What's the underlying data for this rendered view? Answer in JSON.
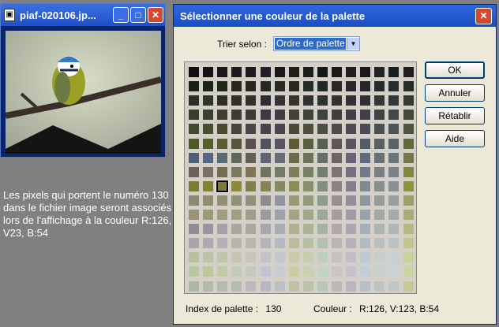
{
  "image_window": {
    "title": "piaf-020106.jp...",
    "minimize": "_",
    "maximize": "□",
    "close": "✕"
  },
  "caption": "Les pixels qui portent le numéro 130 dans le fichier image seront associés lors de l'affichage à la couleur R:126, V23, B:54",
  "dialog": {
    "title": "Sélectionner une couleur de la palette",
    "close": "✕",
    "sort_label": "Trier selon :",
    "sort_value": "Ordre de palette",
    "buttons": {
      "ok": "OK",
      "cancel": "Annuler",
      "reset": "Rétablir",
      "help": "Aide"
    },
    "index_label": "Index de palette :",
    "index_value": "130",
    "color_label": "Couleur :",
    "color_value": "R:126, V:123, B:54"
  },
  "palette": {
    "columns": 16,
    "rows": 16,
    "selected_index": 130,
    "row_colors": [
      [
        "#101010",
        "#141414",
        "#181818",
        "#1a1a22",
        "#1c1c20",
        "#20202a",
        "#1a1a1a",
        "#202018",
        "#18201a",
        "#101818",
        "#1c1818",
        "#202020",
        "#18181e",
        "#222222",
        "#161e1e",
        "#1e1e1e"
      ],
      [
        "#182018",
        "#1c2418",
        "#202818",
        "#26261c",
        "#28241e",
        "#242824",
        "#2a2a24",
        "#282a20",
        "#242c28",
        "#202828",
        "#2c2626",
        "#28282c",
        "#26262a",
        "#242a2a",
        "#262c2c",
        "#282c28"
      ],
      [
        "#283028",
        "#30342a",
        "#2c3024",
        "#303028",
        "#343030",
        "#2c2c34",
        "#343434",
        "#363628",
        "#303430",
        "#2c3430",
        "#363030",
        "#343038",
        "#30303a",
        "#343838",
        "#32383a",
        "#363a30"
      ],
      [
        "#38402c",
        "#3a4030",
        "#404030",
        "#3c3c34",
        "#3e3a3a",
        "#3a3a42",
        "#403c44",
        "#444034",
        "#404438",
        "#3c4440",
        "#443c3c",
        "#423e46",
        "#40404a",
        "#3e4444",
        "#404848",
        "#444a3a"
      ],
      [
        "#404a2c",
        "#48502e",
        "#4a4c30",
        "#464636",
        "#4a4648",
        "#44444e",
        "#484650",
        "#4c4a36",
        "#4c503c",
        "#485048",
        "#504a4a",
        "#4c4854",
        "#4a4a58",
        "#485050",
        "#4c5458",
        "#50563e"
      ],
      [
        "#4c5a28",
        "#54602a",
        "#5a5e30",
        "#585438",
        "#5a5050",
        "#52525e",
        "#585464",
        "#5e5a36",
        "#5c6042",
        "#566052",
        "#605656",
        "#5a5460",
        "#565a68",
        "#586060",
        "#5a6468",
        "#606a3c"
      ],
      [
        "#4e6078",
        "#566484",
        "#5a6a70",
        "#5c6858",
        "#646054",
        "#606474",
        "#6a6c78",
        "#6e6c48",
        "#6c7458",
        "#647068",
        "#6e6464",
        "#6a6474",
        "#646a7c",
        "#687070",
        "#6a767c",
        "#72784a"
      ],
      [
        "#70605a",
        "#7a7060",
        "#786c50",
        "#7a7a58",
        "#7e7654",
        "#6e745e",
        "#747a68",
        "#7c8056",
        "#788068",
        "#708070",
        "#7e7272",
        "#787080",
        "#727a88",
        "#788080",
        "#7a8488",
        "#82883e"
      ],
      [
        "#7e7b36",
        "#84822e",
        "#7e7b36",
        "#8a8a3a",
        "#808048",
        "#888458",
        "#848a60",
        "#8c8c58",
        "#88906a",
        "#828e80",
        "#8c8080",
        "#867e8c",
        "#808890",
        "#868e8e",
        "#889294",
        "#8c9440"
      ],
      [
        "#8a8a70",
        "#908e70",
        "#948e74",
        "#8e9278",
        "#929078",
        "#8e8c88",
        "#9294a0",
        "#989a78",
        "#949c80",
        "#8e9c90",
        "#9a8e8e",
        "#948c9a",
        "#8e96a0",
        "#949c9c",
        "#96a0a2",
        "#9aa26a"
      ],
      [
        "#9a9474",
        "#9e9a78",
        "#a09c80",
        "#9ea082",
        "#a09e88",
        "#9a9aa0",
        "#9ea2aa",
        "#a2a484",
        "#a0a88c",
        "#9aa89c",
        "#a69c9c",
        "#a09aa6",
        "#9aa2ac",
        "#a0a8a8",
        "#a2acae",
        "#a6ae7a"
      ],
      [
        "#908c98",
        "#9a96a0",
        "#a4a2a8",
        "#a8a8a0",
        "#aaa8a0",
        "#a6a6ae",
        "#aaaeb4",
        "#aeb090",
        "#acb496",
        "#a6b4a8",
        "#b2a8a8",
        "#aca6b2",
        "#a6aeb8",
        "#acb4b4",
        "#aeb8ba",
        "#b2ba86"
      ],
      [
        "#a8a4b0",
        "#aeaab4",
        "#b2b0b8",
        "#b6b6ae",
        "#b8b6ae",
        "#b4b4bc",
        "#b6bac0",
        "#babc9c",
        "#b8c0a2",
        "#b2c0b4",
        "#bcb4b4",
        "#b6b2bc",
        "#b2bac4",
        "#b8c0c0",
        "#bac4c6",
        "#bec692"
      ],
      [
        "#b8c0a0",
        "#bcc4a6",
        "#c0c6aa",
        "#c4c6b4",
        "#c6c4bc",
        "#c2c2ca",
        "#c4c8ce",
        "#c8caa8",
        "#c6ceae",
        "#c0cec2",
        "#c8c0c0",
        "#c2bec8",
        "#becad0",
        "#c6cece",
        "#c8d2d4",
        "#cad29c"
      ],
      [
        "#b8c8a0",
        "#bcc89a",
        "#c0caa6",
        "#c4cab8",
        "#c6c8c0",
        "#c4c4d0",
        "#c8ccd2",
        "#cacca6",
        "#c8d0b0",
        "#c4d2c6",
        "#cac4c4",
        "#c6c2cc",
        "#c2ccd4",
        "#c8d0d0",
        "#cad4d6",
        "#ccd4a0"
      ],
      [
        "#aab8a4",
        "#b0bca8",
        "#b4bcae",
        "#b8bcb6",
        "#bcbabe",
        "#b8b8c4",
        "#bcc0c6",
        "#c0c2a0",
        "#bcc4a8",
        "#b8c6bc",
        "#c0b8b8",
        "#bab6c0",
        "#b6c0c8",
        "#bcc4c4",
        "#bec8ca",
        "#c2ca96"
      ]
    ]
  }
}
